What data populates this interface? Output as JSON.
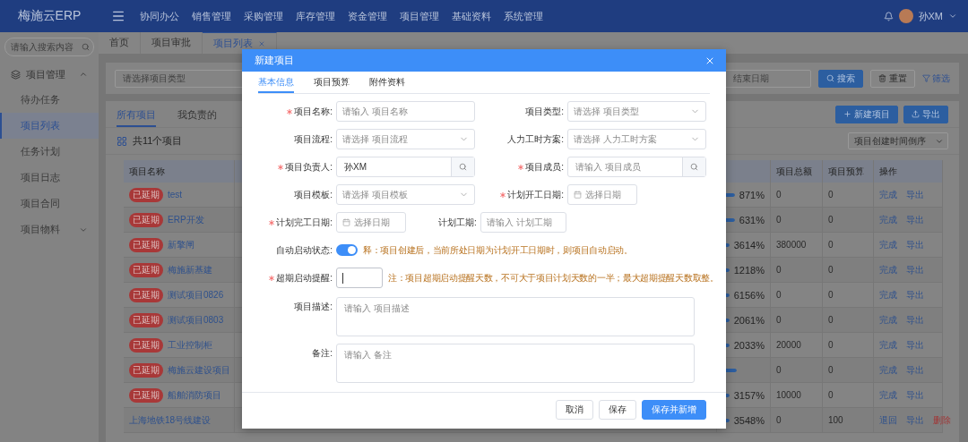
{
  "header": {
    "logo": "梅施云ERP",
    "menu": [
      "协同办公",
      "销售管理",
      "采购管理",
      "库存管理",
      "资金管理",
      "项目管理",
      "基础资料",
      "系统管理"
    ],
    "user": "孙XM"
  },
  "sidebar": {
    "search_placeholder": "请输入搜索内容",
    "group": {
      "label": "项目管理",
      "expanded": true,
      "items": [
        {
          "label": "待办任务",
          "selected": false,
          "kind": "page"
        },
        {
          "label": "项目列表",
          "selected": true,
          "kind": "page"
        },
        {
          "label": "任务计划",
          "selected": false,
          "kind": "page"
        },
        {
          "label": "项目日志",
          "selected": false,
          "kind": "page"
        },
        {
          "label": "项目合同",
          "selected": false,
          "kind": "page"
        },
        {
          "label": "项目物料",
          "selected": false,
          "kind": "folder"
        }
      ]
    }
  },
  "page_tabs": [
    {
      "label": "首页",
      "selected": false,
      "closable": false
    },
    {
      "label": "项目审批",
      "selected": false,
      "closable": false
    },
    {
      "label": "项目列表",
      "selected": true,
      "closable": true
    }
  ],
  "filter": {
    "type_placeholder": "请选择项目类型",
    "end_date_placeholder": "结束日期",
    "search_button": "搜索",
    "reset_button": "重置",
    "filter_link": "筛选"
  },
  "list": {
    "tabs": [
      {
        "label": "所有项目",
        "selected": true
      },
      {
        "label": "我负责的",
        "selected": false
      }
    ],
    "new_button": "新建项目",
    "export_button": "导出",
    "count": "共11个项目",
    "sort": "项目创建时间倒序",
    "table": {
      "columns": {
        "name": "项目名称",
        "total": "项目总额",
        "budget": "项目预算",
        "actions": "操作"
      },
      "rows": [
        {
          "badge": "已延期",
          "name": "test",
          "level": 1,
          "progress": "871%",
          "total": "0",
          "budget": "0",
          "actions": [
            {
              "label": "完成",
              "kind": "link"
            },
            {
              "label": "导出",
              "kind": "link"
            }
          ]
        },
        {
          "badge": "已延期",
          "name": "ERP开发",
          "level": 1,
          "progress": "631%",
          "total": "0",
          "budget": "0",
          "actions": [
            {
              "label": "完成",
              "kind": "link"
            },
            {
              "label": "导出",
              "kind": "link"
            }
          ]
        },
        {
          "badge": "已延期",
          "name": "新擎闸",
          "level": 1,
          "progress": "3614%",
          "total": "380000",
          "budget": "0",
          "actions": [
            {
              "label": "完成",
              "kind": "link"
            },
            {
              "label": "导出",
              "kind": "link"
            }
          ]
        },
        {
          "badge": "已延期",
          "name": "梅施新基建",
          "level": 1,
          "progress": "1218%",
          "total": "0",
          "budget": "0",
          "actions": [
            {
              "label": "完成",
              "kind": "link"
            },
            {
              "label": "导出",
              "kind": "link"
            }
          ]
        },
        {
          "badge": "已延期",
          "name": "测试项目0826",
          "level": 1,
          "progress": "6156%",
          "total": "0",
          "budget": "0",
          "actions": [
            {
              "label": "完成",
              "kind": "link"
            },
            {
              "label": "导出",
              "kind": "link"
            }
          ]
        },
        {
          "badge": "已延期",
          "name": "测试项目0803",
          "level": 1,
          "progress": "2061%",
          "total": "0",
          "budget": "0",
          "actions": [
            {
              "label": "完成",
              "kind": "link"
            },
            {
              "label": "导出",
              "kind": "link"
            }
          ]
        },
        {
          "badge": "已延期",
          "name": "工业控制柜",
          "level": 1,
          "progress": "2033%",
          "total": "20000",
          "budget": "0",
          "actions": [
            {
              "label": "完成",
              "kind": "link"
            },
            {
              "label": "导出",
              "kind": "link"
            }
          ]
        },
        {
          "badge": "已延期",
          "name": "梅施云建设项目",
          "level": 1,
          "total": "0",
          "budget": "0",
          "actions": [
            {
              "label": "完成",
              "kind": "link"
            },
            {
              "label": "导出",
              "kind": "link"
            }
          ]
        },
        {
          "badge": "已延期",
          "name": "船舶消防项目",
          "level": 1,
          "progress": "3157%",
          "total": "10000",
          "budget": "0",
          "actions": [
            {
              "label": "完成",
              "kind": "link"
            },
            {
              "label": "导出",
              "kind": "link"
            }
          ]
        },
        {
          "name": "上海地铁18号线建设",
          "level": 1,
          "progress": "3548%",
          "total": "0",
          "budget": "100",
          "actions": [
            {
              "label": "退回",
              "kind": "link"
            },
            {
              "label": "导出",
              "kind": "link"
            },
            {
              "label": "删除",
              "kind": "danger"
            }
          ]
        }
      ]
    }
  },
  "modal": {
    "title": "新建项目",
    "tabs": [
      {
        "label": "基本信息",
        "selected": true
      },
      {
        "label": "项目预算",
        "selected": false
      },
      {
        "label": "附件资料",
        "selected": false
      }
    ],
    "rows": [
      {
        "kind": "pair",
        "fields": [
          {
            "label": "项目名称:",
            "required": true,
            "kind": "text",
            "placeholder": "请输入 项目名称"
          },
          {
            "label": "项目类型:",
            "required": false,
            "kind": "select",
            "placeholder": "请选择 项目类型"
          }
        ]
      },
      {
        "kind": "pair",
        "fields": [
          {
            "label": "项目流程:",
            "required": false,
            "kind": "select",
            "placeholder": "请选择 项目流程"
          },
          {
            "label": "人力工时方案:",
            "required": false,
            "kind": "select",
            "placeholder": "请选择 人力工时方案"
          }
        ]
      },
      {
        "kind": "pair",
        "fields": [
          {
            "label": "项目负责人:",
            "required": true,
            "kind": "search",
            "value": "孙XM"
          },
          {
            "label": "项目成员:",
            "required": true,
            "kind": "search",
            "placeholder": "请输入 项目成员"
          }
        ]
      },
      {
        "kind": "pair",
        "fields": [
          {
            "label": "项目模板:",
            "required": false,
            "kind": "select",
            "placeholder": "请选择 项目模板"
          },
          {
            "label": "计划开工日期:",
            "required": true,
            "kind": "date",
            "placeholder": "选择日期"
          }
        ]
      },
      {
        "kind": "inline",
        "fields": [
          {
            "label": "计划完工日期:",
            "required": true,
            "kind": "date",
            "placeholder": "选择日期"
          },
          {
            "label": "计划工期:",
            "required": false,
            "kind": "number",
            "placeholder": "请输入 计划工期"
          }
        ]
      },
      {
        "kind": "inline",
        "fields": [
          {
            "label": "自动启动状态:",
            "required": false,
            "kind": "switch",
            "on": true,
            "note": "释：项目创建后，当前所处日期为计划开工日期时，则项目自动启动。"
          }
        ]
      },
      {
        "kind": "inline",
        "fields": [
          {
            "label": "超期启动提醒:",
            "required": true,
            "kind": "number",
            "focused": true,
            "note": "注：项目超期启动提醒天数，不可大于项目计划天数的一半；最大超期提醒天数取整。"
          }
        ]
      },
      {
        "kind": "area",
        "fields": [
          {
            "label": "项目描述:",
            "required": false,
            "kind": "textarea",
            "placeholder": "请输入 项目描述"
          }
        ]
      },
      {
        "kind": "area",
        "fields": [
          {
            "label": "备注:",
            "required": false,
            "kind": "textarea",
            "placeholder": "请输入 备注"
          }
        ]
      }
    ],
    "footer": [
      {
        "label": "取消",
        "kind": "default"
      },
      {
        "label": "保存",
        "kind": "default"
      },
      {
        "label": "保存并新增",
        "kind": "primary"
      }
    ]
  }
}
